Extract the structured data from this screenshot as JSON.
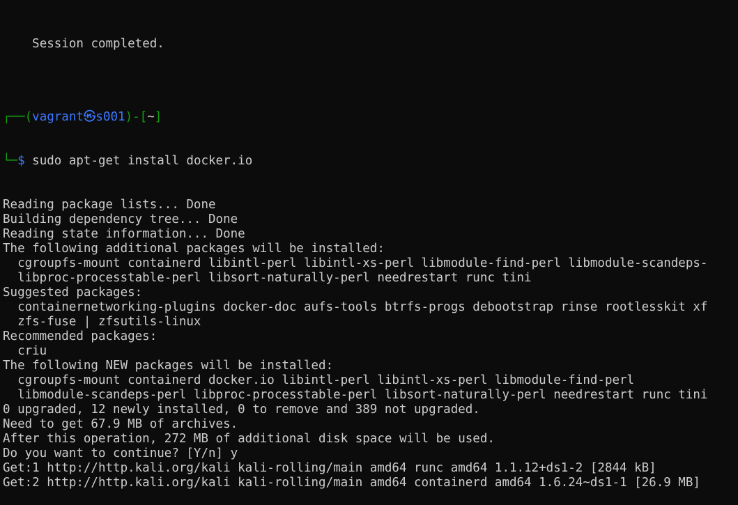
{
  "terminal": {
    "prompt": {
      "frame_top_left": "┌──(",
      "user": "vagrant",
      "at_symbol": "㉿",
      "host": "s001",
      "frame_mid": ")-[",
      "cwd": "~",
      "frame_end": "]",
      "frame_bottom": "└─",
      "sign": "$",
      "command": " sudo apt-get install docker.io"
    },
    "lines_before": [
      "Session completed."
    ],
    "output_lines": [
      "Reading package lists... Done",
      "Building dependency tree... Done",
      "Reading state information... Done",
      "The following additional packages will be installed:",
      "  cgroupfs-mount containerd libintl-perl libintl-xs-perl libmodule-find-perl libmodule-scandeps-",
      "  libproc-processtable-perl libsort-naturally-perl needrestart runc tini",
      "Suggested packages:",
      "  containernetworking-plugins docker-doc aufs-tools btrfs-progs debootstrap rinse rootlesskit xf",
      "  zfs-fuse | zfsutils-linux",
      "Recommended packages:",
      "  criu",
      "The following NEW packages will be installed:",
      "  cgroupfs-mount containerd docker.io libintl-perl libintl-xs-perl libmodule-find-perl",
      "  libmodule-scandeps-perl libproc-processtable-perl libsort-naturally-perl needrestart runc tini",
      "0 upgraded, 12 newly installed, 0 to remove and 389 not upgraded.",
      "Need to get 67.9 MB of archives.",
      "After this operation, 272 MB of additional disk space will be used.",
      "Do you want to continue? [Y/n] y",
      "Get:1 http://http.kali.org/kali kali-rolling/main amd64 runc amd64 1.1.12+ds1-2 [2844 kB]",
      "Get:2 http://http.kali.org/kali kali-rolling/main amd64 containerd amd64 1.6.24~ds1-1 [26.9 MB]"
    ],
    "colors": {
      "background": "#0c0c0c",
      "foreground": "#cccccc",
      "prompt_frame": "#13a10e",
      "prompt_user_host": "#3b78ff"
    }
  }
}
